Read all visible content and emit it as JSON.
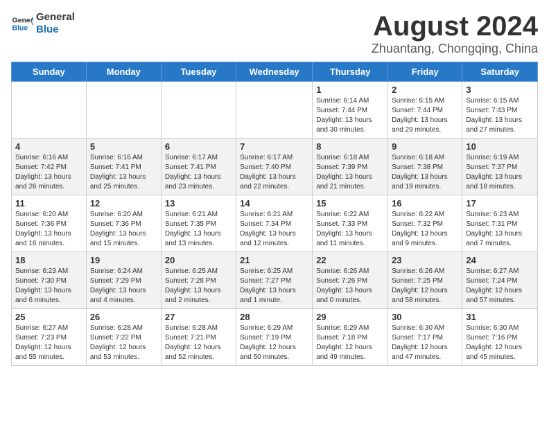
{
  "logo": {
    "line1": "General",
    "line2": "Blue"
  },
  "title": "August 2024",
  "subtitle": "Zhuantang, Chongqing, China",
  "weekdays": [
    "Sunday",
    "Monday",
    "Tuesday",
    "Wednesday",
    "Thursday",
    "Friday",
    "Saturday"
  ],
  "weeks": [
    [
      {
        "day": "",
        "info": ""
      },
      {
        "day": "",
        "info": ""
      },
      {
        "day": "",
        "info": ""
      },
      {
        "day": "",
        "info": ""
      },
      {
        "day": "1",
        "info": "Sunrise: 6:14 AM\nSunset: 7:44 PM\nDaylight: 13 hours and 30 minutes."
      },
      {
        "day": "2",
        "info": "Sunrise: 6:15 AM\nSunset: 7:44 PM\nDaylight: 13 hours and 29 minutes."
      },
      {
        "day": "3",
        "info": "Sunrise: 6:15 AM\nSunset: 7:43 PM\nDaylight: 13 hours and 27 minutes."
      }
    ],
    [
      {
        "day": "4",
        "info": "Sunrise: 6:16 AM\nSunset: 7:42 PM\nDaylight: 13 hours and 26 minutes."
      },
      {
        "day": "5",
        "info": "Sunrise: 6:16 AM\nSunset: 7:41 PM\nDaylight: 13 hours and 25 minutes."
      },
      {
        "day": "6",
        "info": "Sunrise: 6:17 AM\nSunset: 7:41 PM\nDaylight: 13 hours and 23 minutes."
      },
      {
        "day": "7",
        "info": "Sunrise: 6:17 AM\nSunset: 7:40 PM\nDaylight: 13 hours and 22 minutes."
      },
      {
        "day": "8",
        "info": "Sunrise: 6:18 AM\nSunset: 7:39 PM\nDaylight: 13 hours and 21 minutes."
      },
      {
        "day": "9",
        "info": "Sunrise: 6:18 AM\nSunset: 7:38 PM\nDaylight: 13 hours and 19 minutes."
      },
      {
        "day": "10",
        "info": "Sunrise: 6:19 AM\nSunset: 7:37 PM\nDaylight: 13 hours and 18 minutes."
      }
    ],
    [
      {
        "day": "11",
        "info": "Sunrise: 6:20 AM\nSunset: 7:36 PM\nDaylight: 13 hours and 16 minutes."
      },
      {
        "day": "12",
        "info": "Sunrise: 6:20 AM\nSunset: 7:36 PM\nDaylight: 13 hours and 15 minutes."
      },
      {
        "day": "13",
        "info": "Sunrise: 6:21 AM\nSunset: 7:35 PM\nDaylight: 13 hours and 13 minutes."
      },
      {
        "day": "14",
        "info": "Sunrise: 6:21 AM\nSunset: 7:34 PM\nDaylight: 13 hours and 12 minutes."
      },
      {
        "day": "15",
        "info": "Sunrise: 6:22 AM\nSunset: 7:33 PM\nDaylight: 13 hours and 11 minutes."
      },
      {
        "day": "16",
        "info": "Sunrise: 6:22 AM\nSunset: 7:32 PM\nDaylight: 13 hours and 9 minutes."
      },
      {
        "day": "17",
        "info": "Sunrise: 6:23 AM\nSunset: 7:31 PM\nDaylight: 13 hours and 7 minutes."
      }
    ],
    [
      {
        "day": "18",
        "info": "Sunrise: 6:23 AM\nSunset: 7:30 PM\nDaylight: 13 hours and 6 minutes."
      },
      {
        "day": "19",
        "info": "Sunrise: 6:24 AM\nSunset: 7:29 PM\nDaylight: 13 hours and 4 minutes."
      },
      {
        "day": "20",
        "info": "Sunrise: 6:25 AM\nSunset: 7:28 PM\nDaylight: 13 hours and 2 minutes."
      },
      {
        "day": "21",
        "info": "Sunrise: 6:25 AM\nSunset: 7:27 PM\nDaylight: 13 hours and 1 minute."
      },
      {
        "day": "22",
        "info": "Sunrise: 6:26 AM\nSunset: 7:26 PM\nDaylight: 13 hours and 0 minutes."
      },
      {
        "day": "23",
        "info": "Sunrise: 6:26 AM\nSunset: 7:25 PM\nDaylight: 12 hours and 58 minutes."
      },
      {
        "day": "24",
        "info": "Sunrise: 6:27 AM\nSunset: 7:24 PM\nDaylight: 12 hours and 57 minutes."
      }
    ],
    [
      {
        "day": "25",
        "info": "Sunrise: 6:27 AM\nSunset: 7:23 PM\nDaylight: 12 hours and 55 minutes."
      },
      {
        "day": "26",
        "info": "Sunrise: 6:28 AM\nSunset: 7:22 PM\nDaylight: 12 hours and 53 minutes."
      },
      {
        "day": "27",
        "info": "Sunrise: 6:28 AM\nSunset: 7:21 PM\nDaylight: 12 hours and 52 minutes."
      },
      {
        "day": "28",
        "info": "Sunrise: 6:29 AM\nSunset: 7:19 PM\nDaylight: 12 hours and 50 minutes."
      },
      {
        "day": "29",
        "info": "Sunrise: 6:29 AM\nSunset: 7:18 PM\nDaylight: 12 hours and 49 minutes."
      },
      {
        "day": "30",
        "info": "Sunrise: 6:30 AM\nSunset: 7:17 PM\nDaylight: 12 hours and 47 minutes."
      },
      {
        "day": "31",
        "info": "Sunrise: 6:30 AM\nSunset: 7:16 PM\nDaylight: 12 hours and 45 minutes."
      }
    ]
  ]
}
